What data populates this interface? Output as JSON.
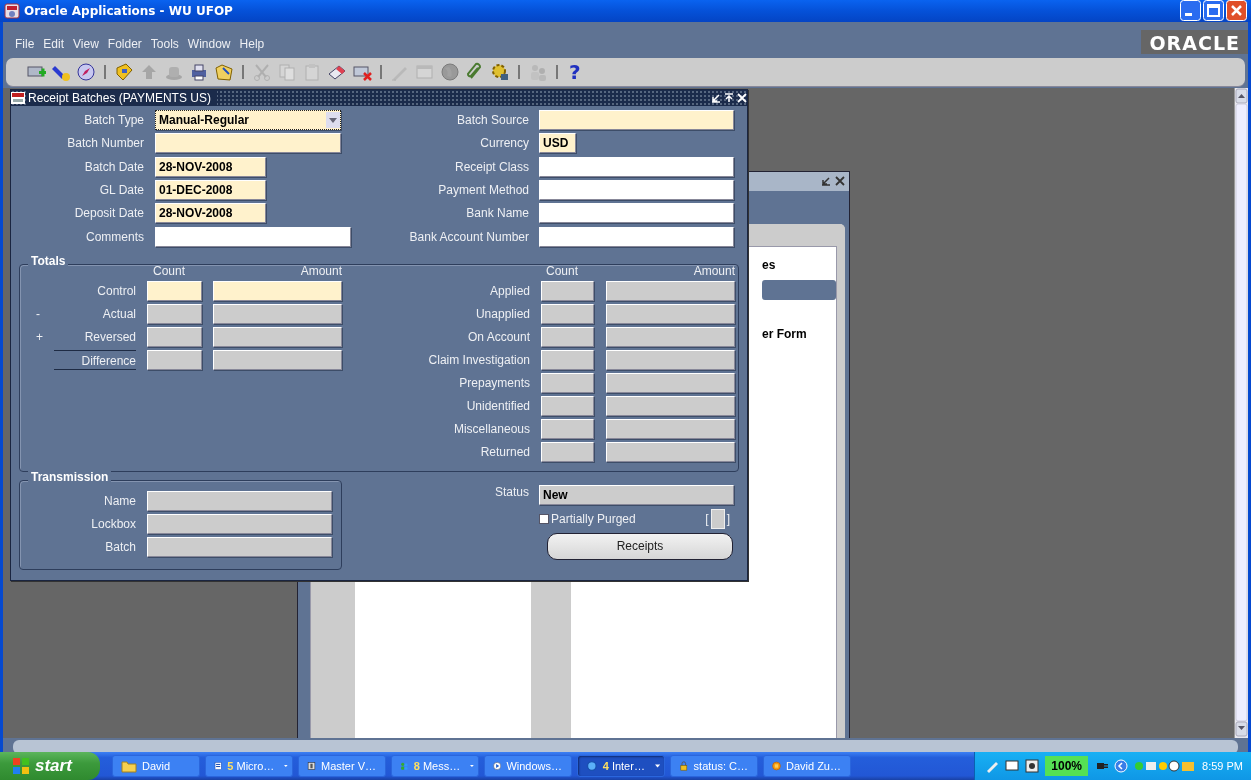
{
  "window": {
    "title": "Oracle Applications - WU UFOP"
  },
  "menu": [
    {
      "label": "File"
    },
    {
      "label": "Edit"
    },
    {
      "label": "View"
    },
    {
      "label": "Folder"
    },
    {
      "label": "Tools"
    },
    {
      "label": "Window"
    },
    {
      "label": "Help"
    }
  ],
  "logo": "ORACLE",
  "toolbar": [
    {
      "kind": "tool",
      "disabled": false
    },
    {
      "kind": "tool",
      "disabled": false
    },
    {
      "kind": "tool",
      "disabled": false
    },
    {
      "kind": "separator"
    },
    {
      "kind": "tool",
      "disabled": false
    },
    {
      "kind": "tool",
      "disabled": true
    },
    {
      "kind": "tool",
      "disabled": true
    },
    {
      "kind": "tool",
      "disabled": false
    },
    {
      "kind": "tool",
      "disabled": false
    },
    {
      "kind": "separator"
    },
    {
      "kind": "tool",
      "disabled": true
    },
    {
      "kind": "tool",
      "disabled": true
    },
    {
      "kind": "tool",
      "disabled": true
    },
    {
      "kind": "tool",
      "disabled": false
    },
    {
      "kind": "tool",
      "disabled": false
    },
    {
      "kind": "separator"
    },
    {
      "kind": "tool",
      "disabled": true
    },
    {
      "kind": "tool",
      "disabled": true
    },
    {
      "kind": "tool",
      "disabled": true
    },
    {
      "kind": "tool",
      "disabled": false
    },
    {
      "kind": "tool",
      "disabled": false
    },
    {
      "kind": "separator"
    },
    {
      "kind": "tool",
      "disabled": true
    },
    {
      "kind": "separator"
    },
    {
      "kind": "help",
      "label": "?",
      "disabled": false
    }
  ],
  "background_window": {
    "list_rows": [
      {
        "text": "es",
        "selected": false
      },
      {
        "selected": true
      },
      {
        "selected": false
      },
      {
        "text": "er Form",
        "selected": false
      }
    ]
  },
  "form": {
    "title": "Receipt Batches (PAYMENTS US)",
    "fields_left": [
      {
        "label": "Batch Type",
        "value": "Manual-Regular",
        "kind": "list",
        "required": true,
        "readonly": false
      },
      {
        "label": "Batch Number",
        "kind": "text",
        "required": true,
        "readonly": false
      },
      {
        "label": "Batch Date",
        "value": "28-NOV-2008",
        "kind": "date",
        "required": true,
        "readonly": false
      },
      {
        "label": "GL Date",
        "value": "01-DEC-2008",
        "kind": "date",
        "required": true,
        "readonly": false
      },
      {
        "label": "Deposit Date",
        "value": "28-NOV-2008",
        "kind": "date",
        "required": true,
        "readonly": false
      },
      {
        "label": "Comments",
        "kind": "long",
        "required": false,
        "readonly": false
      }
    ],
    "fields_right": [
      {
        "label": "Batch Source",
        "kind": "long",
        "required": true,
        "readonly": false
      },
      {
        "label": "Currency",
        "value": "USD",
        "kind": "short",
        "required": true,
        "readonly": false
      },
      {
        "label": "Receipt Class",
        "kind": "long",
        "required": false,
        "readonly": false
      },
      {
        "label": "Payment Method",
        "kind": "long",
        "required": false,
        "readonly": false
      },
      {
        "label": "Bank  Name",
        "kind": "long",
        "required": false,
        "readonly": false
      },
      {
        "label": "Bank Account Number",
        "kind": "long",
        "required": false,
        "readonly": false
      }
    ],
    "totals": {
      "title": "Totals",
      "left_headers": [
        "Count",
        "Amount"
      ],
      "right_headers": [
        "Count",
        "Amount"
      ],
      "left_rows": [
        {
          "label": "Control",
          "kind": "plain",
          "required": true,
          "readonly": false
        },
        {
          "prefix": "-",
          "label": "Actual",
          "kind": "plain",
          "required": false,
          "readonly": true
        },
        {
          "prefix": "+",
          "label": "Reversed",
          "kind": "plain",
          "required": false,
          "readonly": true
        },
        {
          "label": "Difference",
          "kind": "total",
          "required": false,
          "readonly": true
        }
      ],
      "right_rows": [
        {
          "label": "Applied",
          "readonly": true
        },
        {
          "label": "Unapplied",
          "readonly": true
        },
        {
          "label": "On Account",
          "readonly": true
        },
        {
          "label": "Claim Investigation",
          "readonly": true
        },
        {
          "label": "Prepayments",
          "readonly": true
        },
        {
          "label": "Unidentified",
          "readonly": true
        },
        {
          "label": "Miscellaneous",
          "readonly": true
        },
        {
          "label": "Returned",
          "readonly": true
        }
      ]
    },
    "transmission": {
      "title": "Transmission",
      "fields": [
        {
          "label": "Name",
          "readonly": true
        },
        {
          "label": "Lockbox",
          "readonly": true
        },
        {
          "label": "Batch",
          "readonly": true
        }
      ]
    },
    "status": {
      "label": "Status",
      "value": "New",
      "readonly": true
    },
    "partially_purged": {
      "label": "Partially Purged",
      "checked": false
    },
    "indicator": {
      "open": "[",
      "close": "]"
    },
    "button": "Receipts"
  },
  "taskbar": {
    "start": "start",
    "items": [
      {
        "label": "David",
        "selected": false,
        "grouped": false
      },
      {
        "count": "5",
        "label": "Micro…",
        "selected": false,
        "grouped": true
      },
      {
        "label": "Master V…",
        "selected": false,
        "grouped": false
      },
      {
        "count": "8",
        "label": "Mess…",
        "selected": false,
        "grouped": true
      },
      {
        "label": "Windows…",
        "selected": false,
        "grouped": false
      },
      {
        "count": "4",
        "label": "Inter…",
        "selected": true,
        "grouped": true
      },
      {
        "label": "status: C…",
        "selected": false,
        "grouped": false
      },
      {
        "label": "David Zu…",
        "selected": false,
        "grouped": false
      }
    ],
    "battery": "100%",
    "clock": "8:59 PM"
  }
}
